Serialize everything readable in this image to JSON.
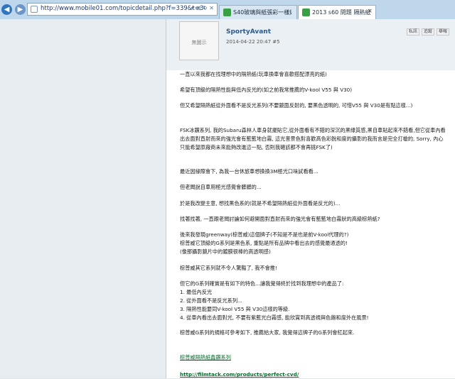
{
  "browser": {
    "url": "http://www.mobile01.com/topicdetail.php?f=339&t=3476473&m=s&s=28&last=...",
    "address_tools": "▾ ⊠ ↻ ✕",
    "tabs": [
      {
        "title": "S40玻璃與紙張彩一樣好 (第1...",
        "active": false
      },
      {
        "title": "2013 s60 問題 隔熱紙選...",
        "active": true
      }
    ]
  },
  "post": {
    "avatar_text": "無圖示",
    "username": "SportyAvant",
    "meta": "2014-04-22 20:47  #5",
    "actions": [
      "私訊",
      "追蹤",
      "舉報"
    ],
    "paragraphs": [
      "一直以來我都在找理想中的隔熱紙(玩車換車會喜歡搭配漂亮的紙)",
      "希望有頂級的隔熱性能與低內反光的(如之前我常推薦的V-kool V55 與 V30)",
      "但又希望隔熱紙從外面看不是反光系列(不要鏡面反射的, 要黑色透明的, 可惜V55 與 V30是有點這樣...)",
      "FSK冰鑽系列, 我的Subaru森林人車身就擺貼它,從外面看有不錯的深沉的黑綠質感,黑自車貼起來不錯看,但它從車內看出去面對直射而來的強光會有藍藍地白霧, 這光害景色對喜歡高色彩銳和度的攝影的我而言是完全打槍的, Sorry, 內心只能希望原廠商未來能夠改進這一點, 否則我確該都不會再挑FSK了)",
      "最近因緣際會下, 為我一台休旅車想換換3M極光口味試看看...",
      "但老闆說自車用極光感覺會髒髒的...",
      "於是我改變主意, 想找黑色系的(就是不希望隔熱紙從外面看是反光的)...",
      "找著找著, 一直跟老闆討論如何避開面對直射而來的強光會有藍藍地白霧狀的高級棕熱紙?",
      "後來我發現greenway(棕普威)這個牌子(不知是不是也是前V-kool代理的?)\n棕普威它頂級的G系列是黑色系, 重點是所有品牌中看出去的感覺最通透的!\n(像那攝影鏡片中的鍍膜很棒的高透明感)",
      "棕普威其它系列就不令人驚豔了, 我不會推!",
      "但它的G系列確實是有如下的特色...讓我覺得終於找到我理想中的產品了:\n1. 最低內反光\n2. 從外面看不是反光系列...\n3. 隔熱性能要同V-kool V55 與 V30這樣的等級.\n4. 從車內看出去面對光, 不要有紫藍光白霧感, 能欣賞到高透視與色飽和度外在風景!",
      "棕普威G系列的規格可參考如下, 推薦給大家, 我覺得這牌子的G系列會紅起來."
    ],
    "link_label": "棕普威隔熱紙鑫鑽系列",
    "url_link": "http://filmtack.com/products/perfect-cvd/"
  }
}
